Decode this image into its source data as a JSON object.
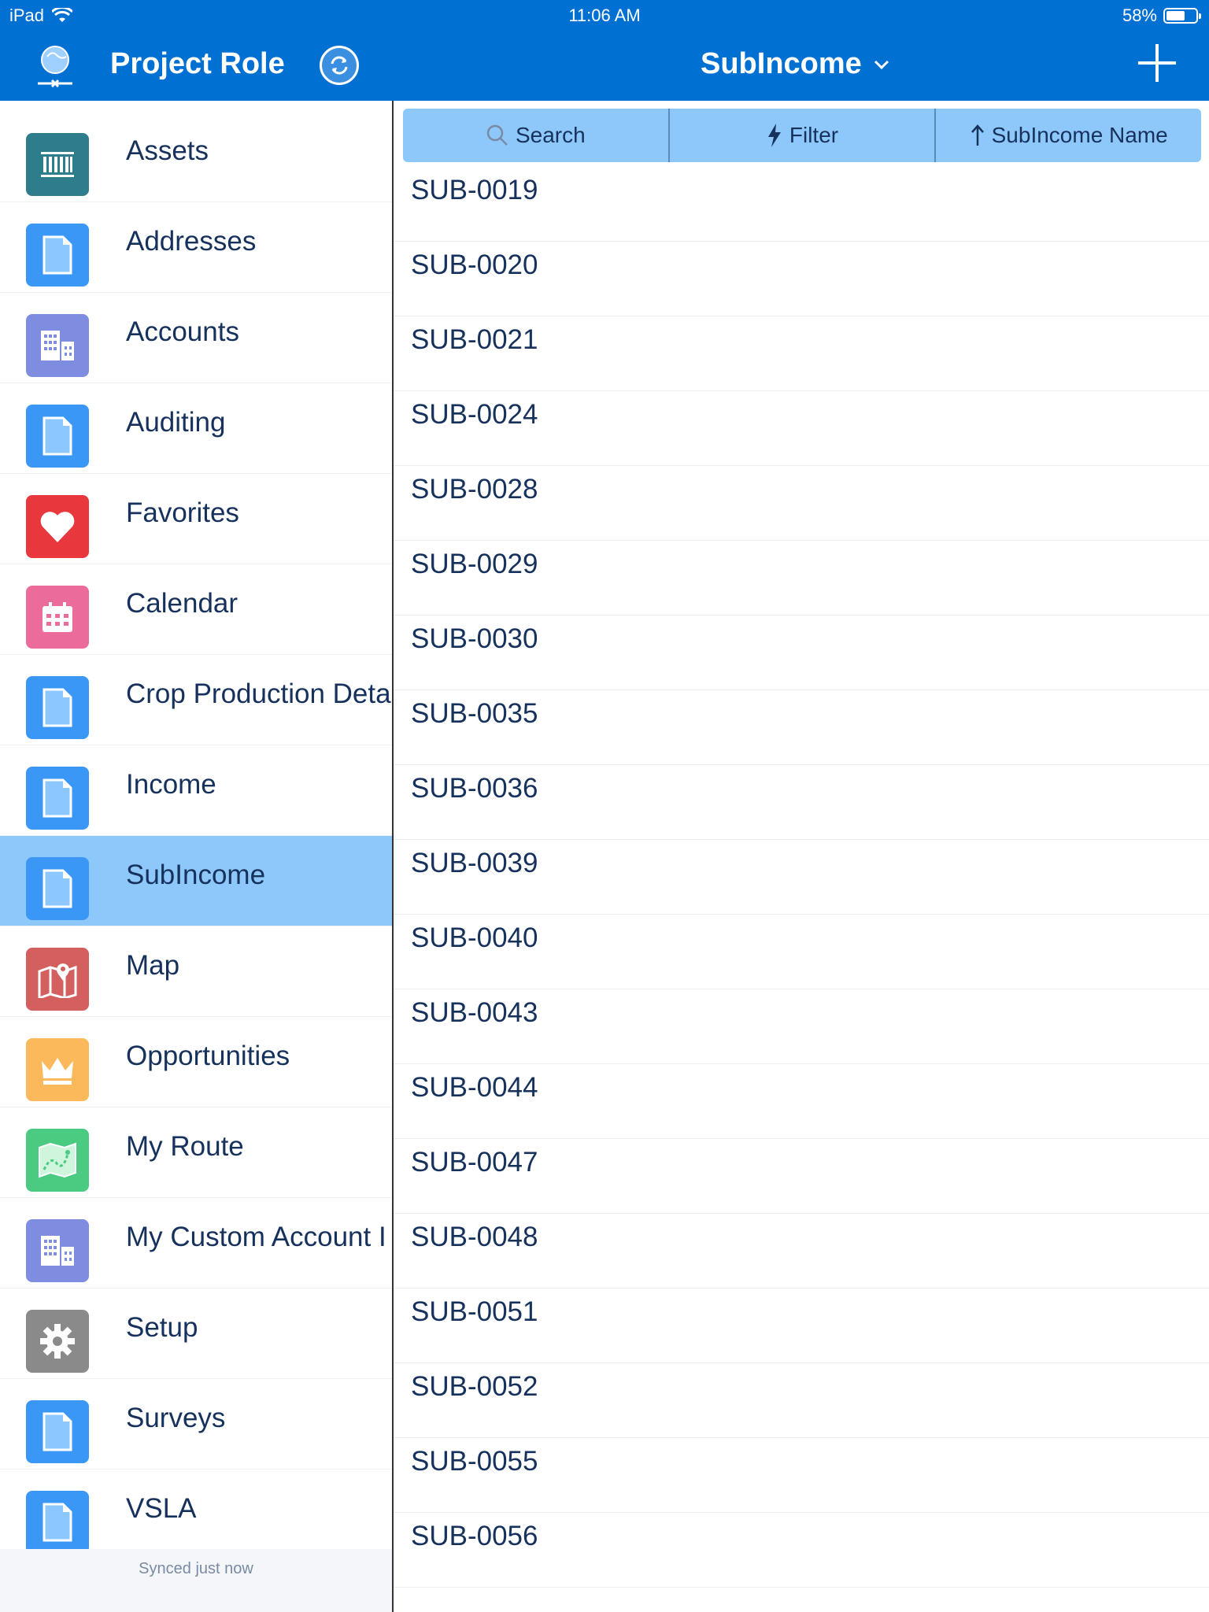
{
  "status_bar": {
    "device": "iPad",
    "time": "11:06 AM",
    "battery": "58%"
  },
  "header": {
    "app_title": "Project Role",
    "object_title": "SubIncome"
  },
  "sidebar": {
    "items": [
      {
        "label": "Assets",
        "icon": "barcode-icon",
        "color": "#2e7d8c"
      },
      {
        "label": "Addresses",
        "icon": "document-icon",
        "color": "#3b97f5"
      },
      {
        "label": "Accounts",
        "icon": "building-icon",
        "color": "#7f8de1"
      },
      {
        "label": "Auditing",
        "icon": "document-icon",
        "color": "#3b97f5"
      },
      {
        "label": "Favorites",
        "icon": "heart-icon",
        "color": "#e8373d"
      },
      {
        "label": "Calendar",
        "icon": "calendar-icon",
        "color": "#eb6b9a"
      },
      {
        "label": "Crop Production Deta",
        "icon": "document-icon",
        "color": "#3b97f5"
      },
      {
        "label": "Income",
        "icon": "document-icon",
        "color": "#3b97f5"
      },
      {
        "label": "SubIncome",
        "icon": "document-icon",
        "color": "#3b97f5",
        "selected": true
      },
      {
        "label": "Map",
        "icon": "map-icon",
        "color": "#d35f5f"
      },
      {
        "label": "Opportunities",
        "icon": "crown-icon",
        "color": "#fcb95b"
      },
      {
        "label": "My Route",
        "icon": "route-icon",
        "color": "#4bca81"
      },
      {
        "label": "My Custom Account I",
        "icon": "building-icon",
        "color": "#7f8de1"
      },
      {
        "label": "Setup",
        "icon": "gear-icon",
        "color": "#8a8a8a"
      },
      {
        "label": "Surveys",
        "icon": "document-icon",
        "color": "#3b97f5"
      },
      {
        "label": "VSLA",
        "icon": "document-icon",
        "color": "#3b97f5"
      }
    ],
    "sync_status": "Synced just now"
  },
  "toolbar": {
    "search_label": "Search",
    "filter_label": "Filter",
    "sort_label": "SubIncome Name"
  },
  "records": [
    "SUB-0019",
    "SUB-0020",
    "SUB-0021",
    "SUB-0024",
    "SUB-0028",
    "SUB-0029",
    "SUB-0030",
    "SUB-0035",
    "SUB-0036",
    "SUB-0039",
    "SUB-0040",
    "SUB-0043",
    "SUB-0044",
    "SUB-0047",
    "SUB-0048",
    "SUB-0051",
    "SUB-0052",
    "SUB-0055",
    "SUB-0056"
  ],
  "colors": {
    "brand": "#0070d2",
    "selected": "#8ec8fb",
    "text": "#16325c"
  }
}
